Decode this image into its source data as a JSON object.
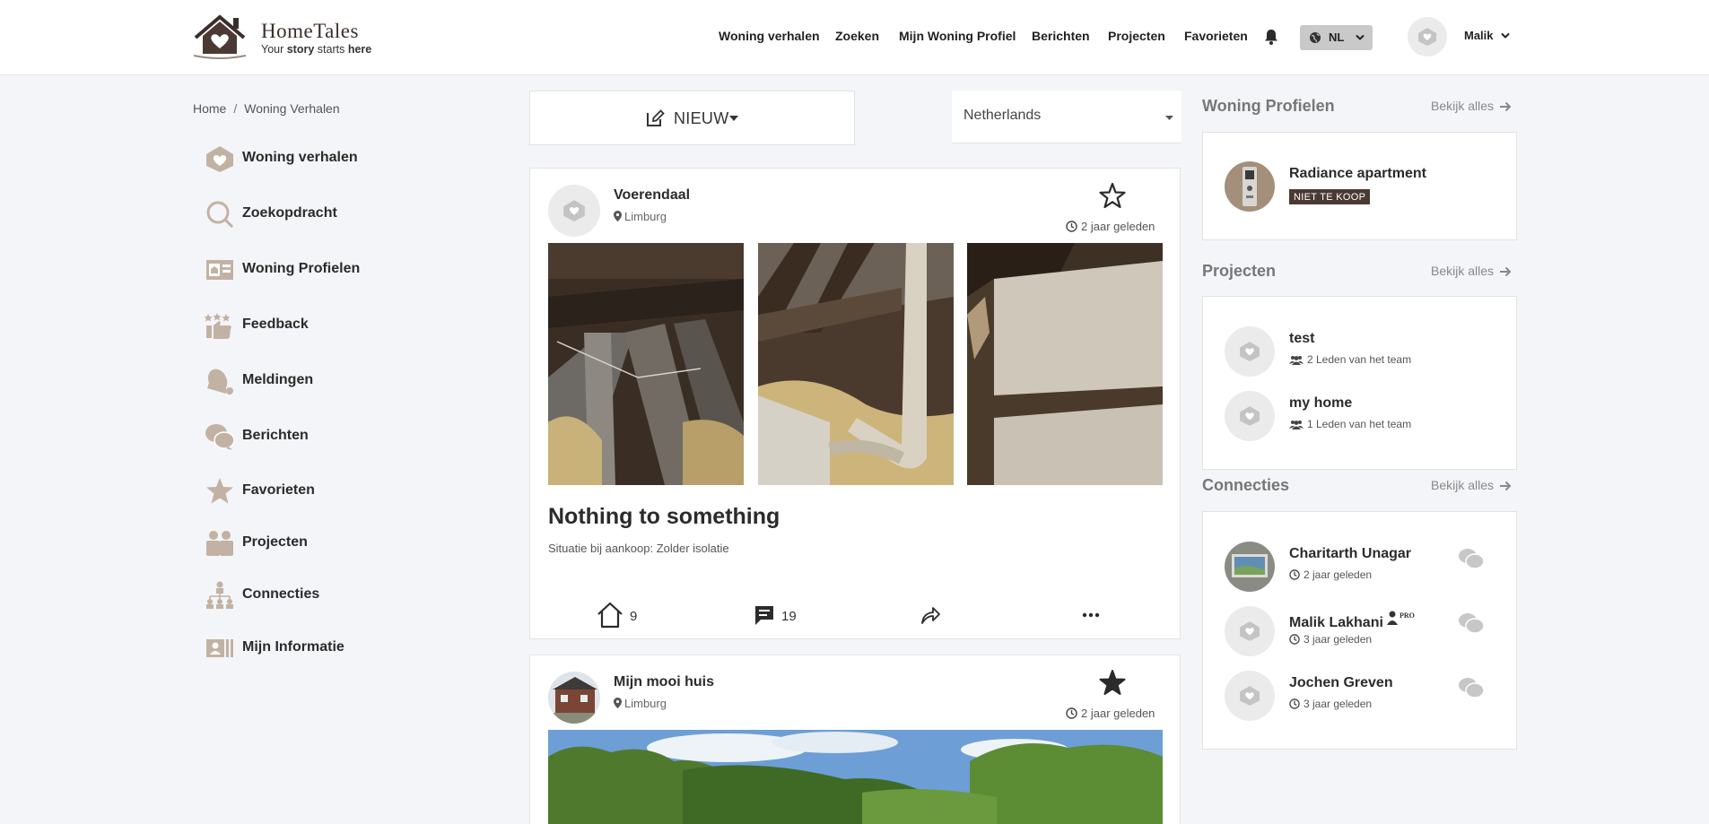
{
  "brand": {
    "name": "HomeTales",
    "tagline_pre": "Your ",
    "tagline_story": "story",
    "tagline_mid": " starts ",
    "tagline_here": "here"
  },
  "nav": [
    {
      "label": "Woning verhalen"
    },
    {
      "label": "Zoeken"
    },
    {
      "label": "Mijn Woning Profiel"
    },
    {
      "label": "Berichten"
    },
    {
      "label": "Projecten"
    },
    {
      "label": "Favorieten"
    }
  ],
  "lang": {
    "code": "NL"
  },
  "user": {
    "name": "Malik"
  },
  "breadcrumb": {
    "home": "Home",
    "sep": "/",
    "current": "Woning Verhalen"
  },
  "sidebar": {
    "items": [
      {
        "label": "Woning verhalen",
        "icon": "house-heart-icon"
      },
      {
        "label": "Zoekopdracht",
        "icon": "search-icon"
      },
      {
        "label": "Woning Profielen",
        "icon": "profile-card-icon"
      },
      {
        "label": "Feedback",
        "icon": "thumbs-stars-icon"
      },
      {
        "label": "Meldingen",
        "icon": "bell-icon"
      },
      {
        "label": "Berichten",
        "icon": "chat-bubbles-icon"
      },
      {
        "label": "Favorieten",
        "icon": "star-icon"
      },
      {
        "label": "Projecten",
        "icon": "people-icon"
      },
      {
        "label": "Connecties",
        "icon": "network-icon"
      },
      {
        "label": "Mijn Informatie",
        "icon": "id-card-icon"
      }
    ]
  },
  "feed": {
    "new_label": "NIEUW",
    "country": "Netherlands",
    "posts": [
      {
        "author": "Voerendaal",
        "location": "Limburg",
        "time": "2 jaar geleden",
        "favorited": false,
        "title": "Nothing to something",
        "subtitle": "Situatie bij aankoop: Zolder isolatie",
        "likes": "9",
        "comments": "19"
      },
      {
        "author": "Mijn mooi huis",
        "location": "Limburg",
        "time": "2 jaar geleden",
        "favorited": true
      }
    ]
  },
  "right": {
    "view_all": "Bekijk alles",
    "profiles": {
      "heading": "Woning Profielen",
      "items": [
        {
          "name": "Radiance apartment",
          "badge": "NIET TE KOOP"
        }
      ]
    },
    "projects": {
      "heading": "Projecten",
      "items": [
        {
          "name": "test",
          "members": "2 Leden van het team"
        },
        {
          "name": "my home",
          "members": "1 Leden van het team"
        }
      ]
    },
    "connections": {
      "heading": "Connecties",
      "items": [
        {
          "name": "Charitarth Unagar",
          "time": "2 jaar geleden"
        },
        {
          "name": "Malik Lakhani",
          "time": "3 jaar geleden",
          "pro": "PRO"
        },
        {
          "name": "Jochen Greven",
          "time": "3 jaar geleden"
        }
      ]
    }
  },
  "colors": {
    "accent": "#4a3a33",
    "icon_tan": "#c2b2a3",
    "text": "#2b2b2b",
    "muted": "#777777"
  }
}
